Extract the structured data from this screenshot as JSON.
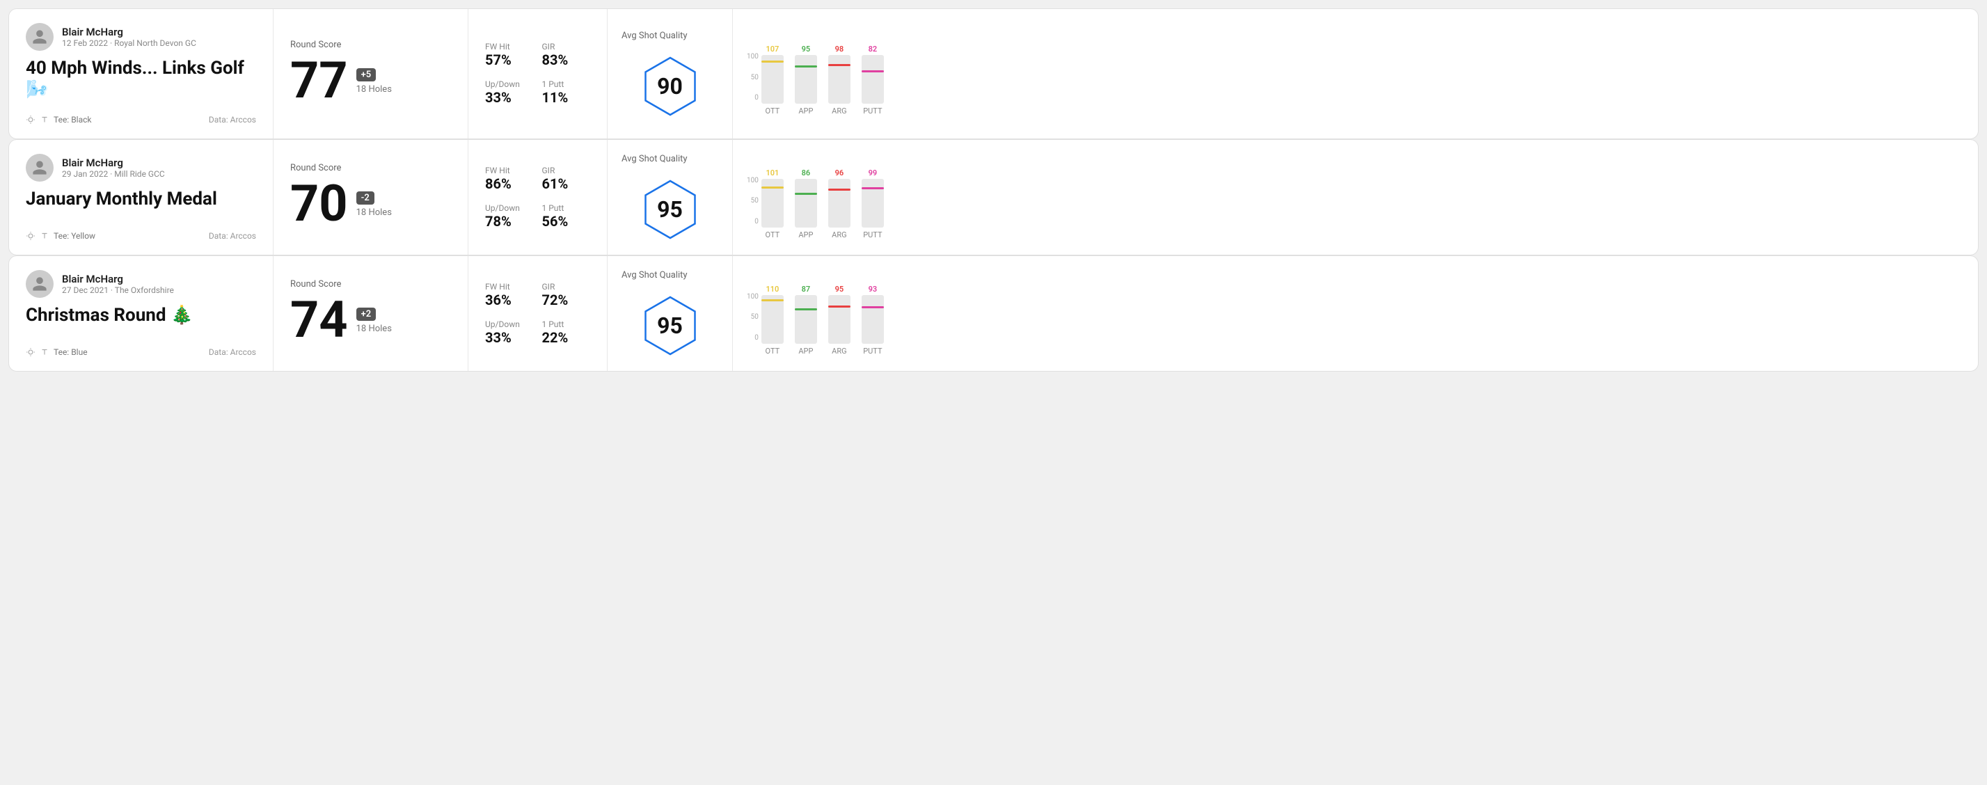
{
  "rounds": [
    {
      "id": "round1",
      "user": {
        "name": "Blair McHarg",
        "date": "12 Feb 2022",
        "club": "Royal North Devon GC"
      },
      "title": "40 Mph Winds... Links Golf 🌬️",
      "tee": "Black",
      "data_source": "Data: Arccos",
      "round_score_label": "Round Score",
      "score": "77",
      "badge": "+5",
      "holes": "18 Holes",
      "fw_hit_label": "FW Hit",
      "fw_hit": "57%",
      "gir_label": "GIR",
      "gir": "83%",
      "updown_label": "Up/Down",
      "updown": "33%",
      "one_putt_label": "1 Putt",
      "one_putt": "11%",
      "avg_label": "Avg Shot Quality",
      "quality_score": "90",
      "chart": {
        "columns": [
          {
            "label": "OTT",
            "value": 107,
            "color": "#e8c840"
          },
          {
            "label": "APP",
            "value": 95,
            "color": "#4caf50"
          },
          {
            "label": "ARG",
            "value": 98,
            "color": "#e84040"
          },
          {
            "label": "PUTT",
            "value": 82,
            "color": "#e040a0"
          }
        ]
      }
    },
    {
      "id": "round2",
      "user": {
        "name": "Blair McHarg",
        "date": "29 Jan 2022",
        "club": "Mill Ride GCC"
      },
      "title": "January Monthly Medal",
      "tee": "Yellow",
      "data_source": "Data: Arccos",
      "round_score_label": "Round Score",
      "score": "70",
      "badge": "-2",
      "holes": "18 Holes",
      "fw_hit_label": "FW Hit",
      "fw_hit": "86%",
      "gir_label": "GIR",
      "gir": "61%",
      "updown_label": "Up/Down",
      "updown": "78%",
      "one_putt_label": "1 Putt",
      "one_putt": "56%",
      "avg_label": "Avg Shot Quality",
      "quality_score": "95",
      "chart": {
        "columns": [
          {
            "label": "OTT",
            "value": 101,
            "color": "#e8c840"
          },
          {
            "label": "APP",
            "value": 86,
            "color": "#4caf50"
          },
          {
            "label": "ARG",
            "value": 96,
            "color": "#e84040"
          },
          {
            "label": "PUTT",
            "value": 99,
            "color": "#e040a0"
          }
        ]
      }
    },
    {
      "id": "round3",
      "user": {
        "name": "Blair McHarg",
        "date": "27 Dec 2021",
        "club": "The Oxfordshire"
      },
      "title": "Christmas Round 🎄",
      "tee": "Blue",
      "data_source": "Data: Arccos",
      "round_score_label": "Round Score",
      "score": "74",
      "badge": "+2",
      "holes": "18 Holes",
      "fw_hit_label": "FW Hit",
      "fw_hit": "36%",
      "gir_label": "GIR",
      "gir": "72%",
      "updown_label": "Up/Down",
      "updown": "33%",
      "one_putt_label": "1 Putt",
      "one_putt": "22%",
      "avg_label": "Avg Shot Quality",
      "quality_score": "95",
      "chart": {
        "columns": [
          {
            "label": "OTT",
            "value": 110,
            "color": "#e8c840"
          },
          {
            "label": "APP",
            "value": 87,
            "color": "#4caf50"
          },
          {
            "label": "ARG",
            "value": 95,
            "color": "#e84040"
          },
          {
            "label": "PUTT",
            "value": 93,
            "color": "#e040a0"
          }
        ]
      }
    }
  ],
  "y_axis": {
    "top": "100",
    "mid": "50",
    "bottom": "0"
  }
}
